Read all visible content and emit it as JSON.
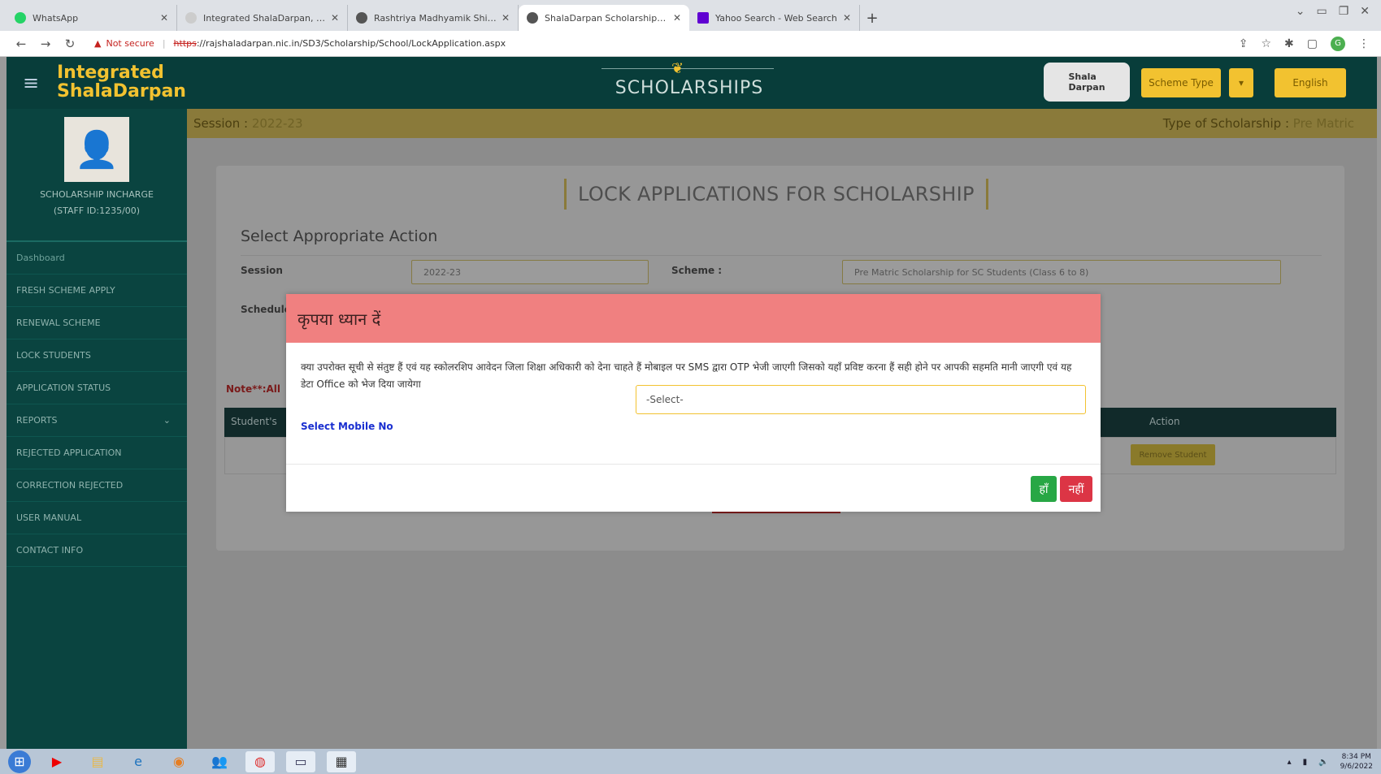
{
  "browser": {
    "tabs": [
      {
        "label": "WhatsApp",
        "color": "#25d366",
        "active": false
      },
      {
        "label": "Integrated ShalaDarpan, Rajasth",
        "color": "#cccccc",
        "active": false
      },
      {
        "label": "Rashtriya Madhyamik Shiksha",
        "color": "#555555",
        "active": false
      },
      {
        "label": "ShalaDarpan Scholarship Portal",
        "color": "#555555",
        "active": true
      },
      {
        "label": "Yahoo Search - Web Search",
        "color": "#6001d2",
        "active": false
      }
    ],
    "not_secure": "Not secure",
    "url_scheme": "https",
    "url_rest": "://rajshaladarpan.nic.in/SD3/Scholarship/School/LockApplication.aspx"
  },
  "header": {
    "logo_line1": "Integrated",
    "logo_line2": "ShalaDarpan",
    "title": "SCHOLARSHIPS",
    "scheme_type_label": "Scheme Type",
    "lang_label": "English"
  },
  "sidebar": {
    "role": "SCHOLARSHIP INCHARGE",
    "staff_id": "(STAFF ID:1235/00)",
    "items": [
      {
        "label": "Dashboard"
      },
      {
        "label": "FRESH SCHEME APPLY"
      },
      {
        "label": "RENEWAL SCHEME"
      },
      {
        "label": "LOCK STUDENTS"
      },
      {
        "label": "APPLICATION STATUS"
      },
      {
        "label": "REPORTS"
      },
      {
        "label": "REJECTED APPLICATION"
      },
      {
        "label": "CORRECTION REJECTED"
      },
      {
        "label": "USER MANUAL"
      },
      {
        "label": "CONTACT INFO"
      }
    ]
  },
  "content": {
    "session_label": "Session :",
    "session_value": "2022-23",
    "type_label": "Type of Scholarship :",
    "type_value": "Pre Matric",
    "page_title": "LOCK APPLICATIONS FOR SCHOLARSHIP",
    "section_title": "Select Appropriate Action",
    "session_field_label": "Session",
    "session_field_value": "2022-23",
    "scheme_field_label": "Scheme :",
    "scheme_field_value": "Pre Matric Scholarship for SC Students (Class 6 to 8)",
    "schedule_label": "Schedule",
    "note": "Note**:All",
    "table_headers": {
      "student": "Student's",
      "action": "Action"
    },
    "remove_label": "Remove Student"
  },
  "modal": {
    "title": "कृपया ध्यान दें",
    "message": "क्या उपरोक्त सूची से संतुष्ट हैं एवं यह स्कोलरशिप आवेदन जिला शिक्षा अधिकारी को देना चाहते हैं मोबाइल पर SMS द्वारा OTP भेजी जाएगी जिसको यहाँ प्रविष्ट करना हैं सही होने पर आपकी सहमति मानी जाएगी एवं यह डेटा Office को भेज दिया जायेगा",
    "mobile_label": "Select Mobile No",
    "select_value": "-Select-",
    "yes": "हाँ",
    "no": "नहीं"
  },
  "taskbar": {
    "time": "8:34 PM",
    "date": "9/6/2022"
  }
}
